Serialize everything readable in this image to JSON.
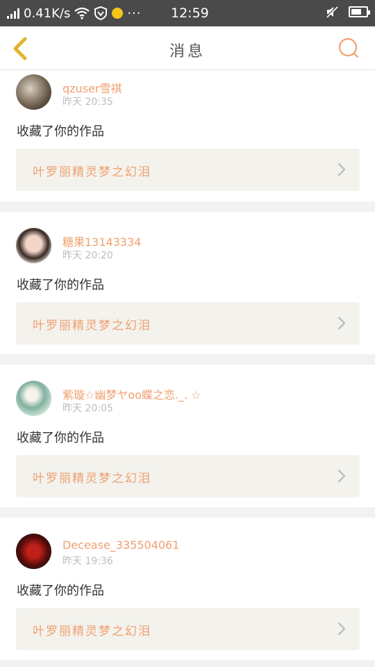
{
  "status_bar": {
    "speed": "0.41K/s",
    "time": "12:59",
    "more": "···"
  },
  "nav": {
    "title": "消息",
    "back_icon": "chevron-left-icon",
    "search_icon": "search-icon"
  },
  "colors": {
    "accent": "#f0a070",
    "status_bar_bg": "#4a4a4a",
    "back_arrow": "#e0b530",
    "work_bg": "#f3f2ed"
  },
  "messages": [
    {
      "username": "qzuser雪祺",
      "time": "昨天 20:35",
      "action": "收藏了你的作品",
      "work_title": "叶罗丽精灵梦之幻泪"
    },
    {
      "username": "糖果13143334",
      "time": "昨天 20:20",
      "action": "收藏了你的作品",
      "work_title": "叶罗丽精灵梦之幻泪"
    },
    {
      "username": "紫璇☆幽梦ヤoo蝶之恋._. ☆",
      "time": "昨天 20:05",
      "action": "收藏了你的作品",
      "work_title": "叶罗丽精灵梦之幻泪"
    },
    {
      "username": "Decease_335504061",
      "time": "昨天 19:36",
      "action": "收藏了你的作品",
      "work_title": "叶罗丽精灵梦之幻泪"
    }
  ]
}
